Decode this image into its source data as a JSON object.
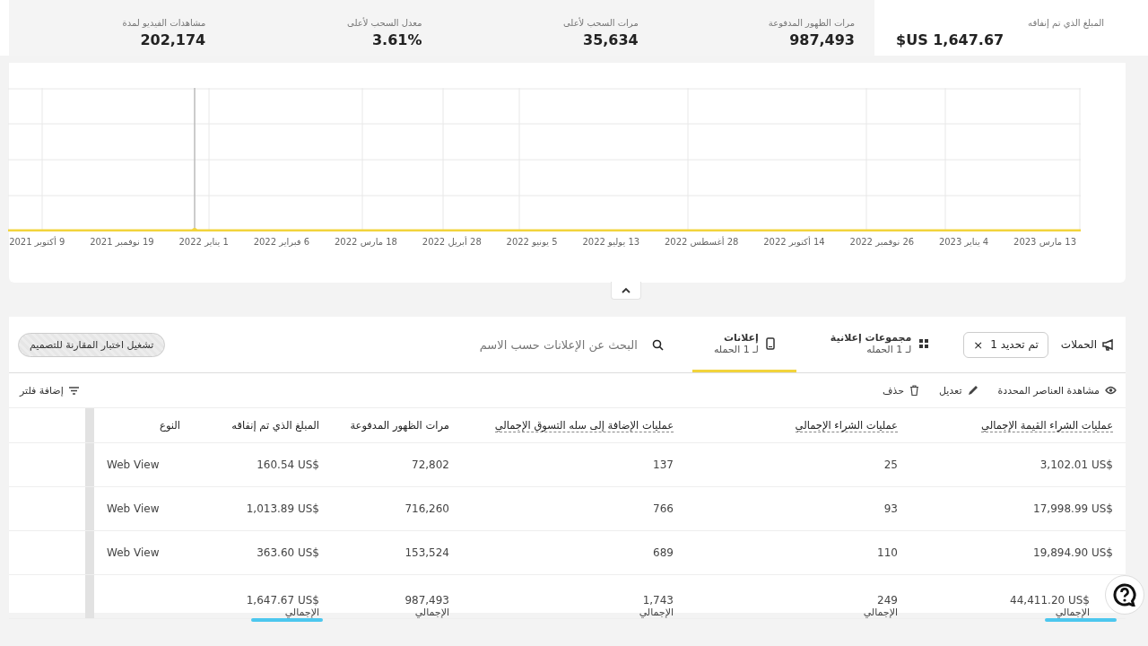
{
  "stats": [
    {
      "label": "مرات الظهور المدفوعة",
      "value": "987,493"
    },
    {
      "label": "مرات السحب لأعلى",
      "value": "35,634"
    },
    {
      "label": "معدل السحب لأعلى",
      "value": "3.61%"
    },
    {
      "label": "مشاهدات الفيديو لمدة",
      "value": "202,174"
    }
  ],
  "spend": {
    "label": "المبلغ الذي تم إنفاقه",
    "value": "$US 1,647.67"
  },
  "chart": {
    "x_labels": [
      "13 مارس 2023",
      "4 يناير 2023",
      "26 نوفمبر 2022",
      "14 أكتوبر 2022",
      "28 أغسطس 2022",
      "13 يوليو 2022",
      "5 يونيو 2022",
      "28 أبريل 2022",
      "18 مارس 2022",
      "6 فبراير 2022",
      "1 يناير 2022",
      "19 نوفمبر 2021",
      "9 أكتوبر 2021"
    ]
  },
  "nav": {
    "campaigns": "الحملات",
    "chip": "تم تحديد 1",
    "chip_close": "×",
    "tabs": [
      {
        "label": "مجموعات إعلانية",
        "sub": "لـ 1 الحمله",
        "kind": "grid",
        "selected": false
      },
      {
        "label": "إعلانات",
        "sub": "لـ 1 الحمله",
        "kind": "phone",
        "selected": true
      }
    ],
    "search": {
      "placeholder": "البحث عن الإعلانات حسب الاسم"
    },
    "compare_button": "تشغيل اختبار المقارنة للتصميم"
  },
  "actions": [
    {
      "label": "مشاهدة العناصر المحددة",
      "kind": "eye"
    },
    {
      "label": "تعديل",
      "kind": "pencil"
    },
    {
      "label": "حذف",
      "kind": "trash"
    }
  ],
  "add_filter": "إضافة فلتر",
  "table": {
    "columns": [
      {
        "label": "عمليات الشراء القيمة الإجمالي",
        "dashed": true
      },
      {
        "label": "عمليات الشراء الإجمالي",
        "dashed": true
      },
      {
        "label": "عمليات الإضافة إلى سله التسوق الإجمالي",
        "dashed": true
      },
      {
        "label": "مرات الظهور المدفوعة",
        "dashed": false
      },
      {
        "label": "المبلغ الذي تم إنفاقه",
        "dashed": false
      },
      {
        "label": "النوع",
        "dashed": false
      }
    ],
    "rows": [
      [
        "3,102.01 US$",
        "25",
        "137",
        "72,802",
        "160.54 US$",
        "Web View"
      ],
      [
        "17,998.99 US$",
        "93",
        "766",
        "716,260",
        "1,013.89 US$",
        "Web View"
      ],
      [
        "19,894.90 US$",
        "110",
        "689",
        "153,524",
        "363.60 US$",
        "Web View"
      ]
    ],
    "totals": [
      {
        "value": "44,411.20 US$",
        "label": "الإجمالي",
        "highlighted": true
      },
      {
        "value": "249",
        "label": "الإجمالي",
        "highlighted": false
      },
      {
        "value": "1,743",
        "label": "الإجمالي",
        "highlighted": false
      },
      {
        "value": "987,493",
        "label": "الإجمالي",
        "highlighted": false
      },
      {
        "value": "1,647.67 US$",
        "label": "الإجمالي",
        "highlighted": true
      }
    ]
  }
}
